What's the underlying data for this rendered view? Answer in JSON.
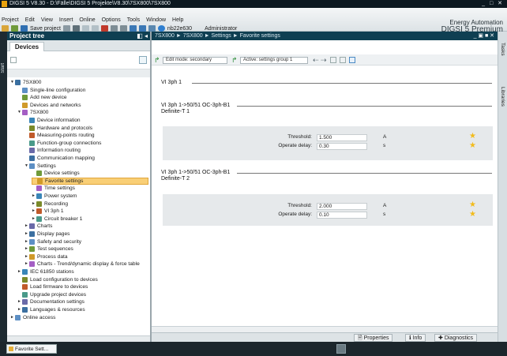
{
  "title": "DIGSI 5 V8.30 - D:\\Fälle\\DIGSI 5 Projekte\\V8.30\\7SX800\\7SX800",
  "menu": [
    "Project",
    "Edit",
    "View",
    "Insert",
    "Online",
    "Options",
    "Tools",
    "Window",
    "Help"
  ],
  "toolbar": {
    "save_label": "Save project",
    "user": "nb22e630",
    "role": "Administrator"
  },
  "brand": {
    "line1": "Energy Automation",
    "line2": "DIGSI 5 Premium"
  },
  "start_label": "Start",
  "project_tree": {
    "title": "Project tree",
    "tab": "Devices",
    "items": [
      {
        "label": "7SX800",
        "depth": 0,
        "expander": "▼"
      },
      {
        "label": "Single-line configuration",
        "depth": 1,
        "expander": ""
      },
      {
        "label": "Add new device",
        "depth": 1,
        "expander": ""
      },
      {
        "label": "Devices and networks",
        "depth": 1,
        "expander": ""
      },
      {
        "label": "7SX800",
        "depth": 1,
        "expander": "▼"
      },
      {
        "label": "Device information",
        "depth": 2,
        "expander": ""
      },
      {
        "label": "Hardware and protocols",
        "depth": 2,
        "expander": ""
      },
      {
        "label": "Measuring-points routing",
        "depth": 2,
        "expander": ""
      },
      {
        "label": "Function-group connections",
        "depth": 2,
        "expander": ""
      },
      {
        "label": "Information routing",
        "depth": 2,
        "expander": ""
      },
      {
        "label": "Communication mapping",
        "depth": 2,
        "expander": ""
      },
      {
        "label": "Settings",
        "depth": 2,
        "expander": "▼"
      },
      {
        "label": "Device settings",
        "depth": 3,
        "expander": ""
      },
      {
        "label": "Favorite settings",
        "depth": 3,
        "expander": ""
      },
      {
        "label": "Time settings",
        "depth": 3,
        "expander": ""
      },
      {
        "label": "Power system",
        "depth": 3,
        "expander": "►"
      },
      {
        "label": "Recording",
        "depth": 3,
        "expander": "►"
      },
      {
        "label": "VI 3ph 1",
        "depth": 3,
        "expander": "►"
      },
      {
        "label": "Circuit breaker 1",
        "depth": 3,
        "expander": "►"
      },
      {
        "label": "Charts",
        "depth": 2,
        "expander": "►"
      },
      {
        "label": "Display pages",
        "depth": 2,
        "expander": "►"
      },
      {
        "label": "Safety and security",
        "depth": 2,
        "expander": "►"
      },
      {
        "label": "Test sequences",
        "depth": 2,
        "expander": "►"
      },
      {
        "label": "Process data",
        "depth": 2,
        "expander": "►"
      },
      {
        "label": "Charts - Trend/dynamic display & force table",
        "depth": 2,
        "expander": "►"
      },
      {
        "label": "IEC 61850 stations",
        "depth": 1,
        "expander": "►"
      },
      {
        "label": "Load configuration to devices",
        "depth": 1,
        "expander": ""
      },
      {
        "label": "Load firmware to devices",
        "depth": 1,
        "expander": ""
      },
      {
        "label": "Upgrade project devices",
        "depth": 1,
        "expander": ""
      },
      {
        "label": "Documentation settings",
        "depth": 1,
        "expander": "►"
      },
      {
        "label": "Languages & resources",
        "depth": 1,
        "expander": "►"
      },
      {
        "label": "Online access",
        "depth": 0,
        "expander": "►"
      }
    ],
    "selected_label": "Favorite settings"
  },
  "editor": {
    "breadcrumb": "7SX800 ► 7SX800 ► Settings ► Favorite settings",
    "edit_mode": "Edit mode: secondary",
    "active_group": "Active: settings group 1",
    "section1": "VI 3ph 1",
    "section2_line1": "VI 3ph 1->50/51 OC-3ph-B1",
    "section2_line2": "Definite-T 1",
    "section3_line1": "VI 3ph 1->50/51 OC-3ph-B1",
    "section3_line2": "Definite-T 2",
    "group1": {
      "threshold_label": "Threshold:",
      "threshold_value": "1.500",
      "threshold_unit": "A",
      "delay_label": "Operate delay:",
      "delay_value": "0.30",
      "delay_unit": "s"
    },
    "group2": {
      "threshold_label": "Threshold:",
      "threshold_value": "2.000",
      "threshold_unit": "A",
      "delay_label": "Operate delay:",
      "delay_value": "0.10",
      "delay_unit": "s"
    }
  },
  "bottom_tabs": {
    "properties": "Properties",
    "info": "Info",
    "diagnostics": "Diagnostics"
  },
  "right_tabs": [
    "Tasks",
    "Libraries"
  ],
  "taskbar_label": "Favorite Sett...",
  "colors": {
    "header": "#0f3f52",
    "selection": "#f9cf76",
    "group_bg": "#e6e9eb",
    "star": "#f2bb1a"
  }
}
